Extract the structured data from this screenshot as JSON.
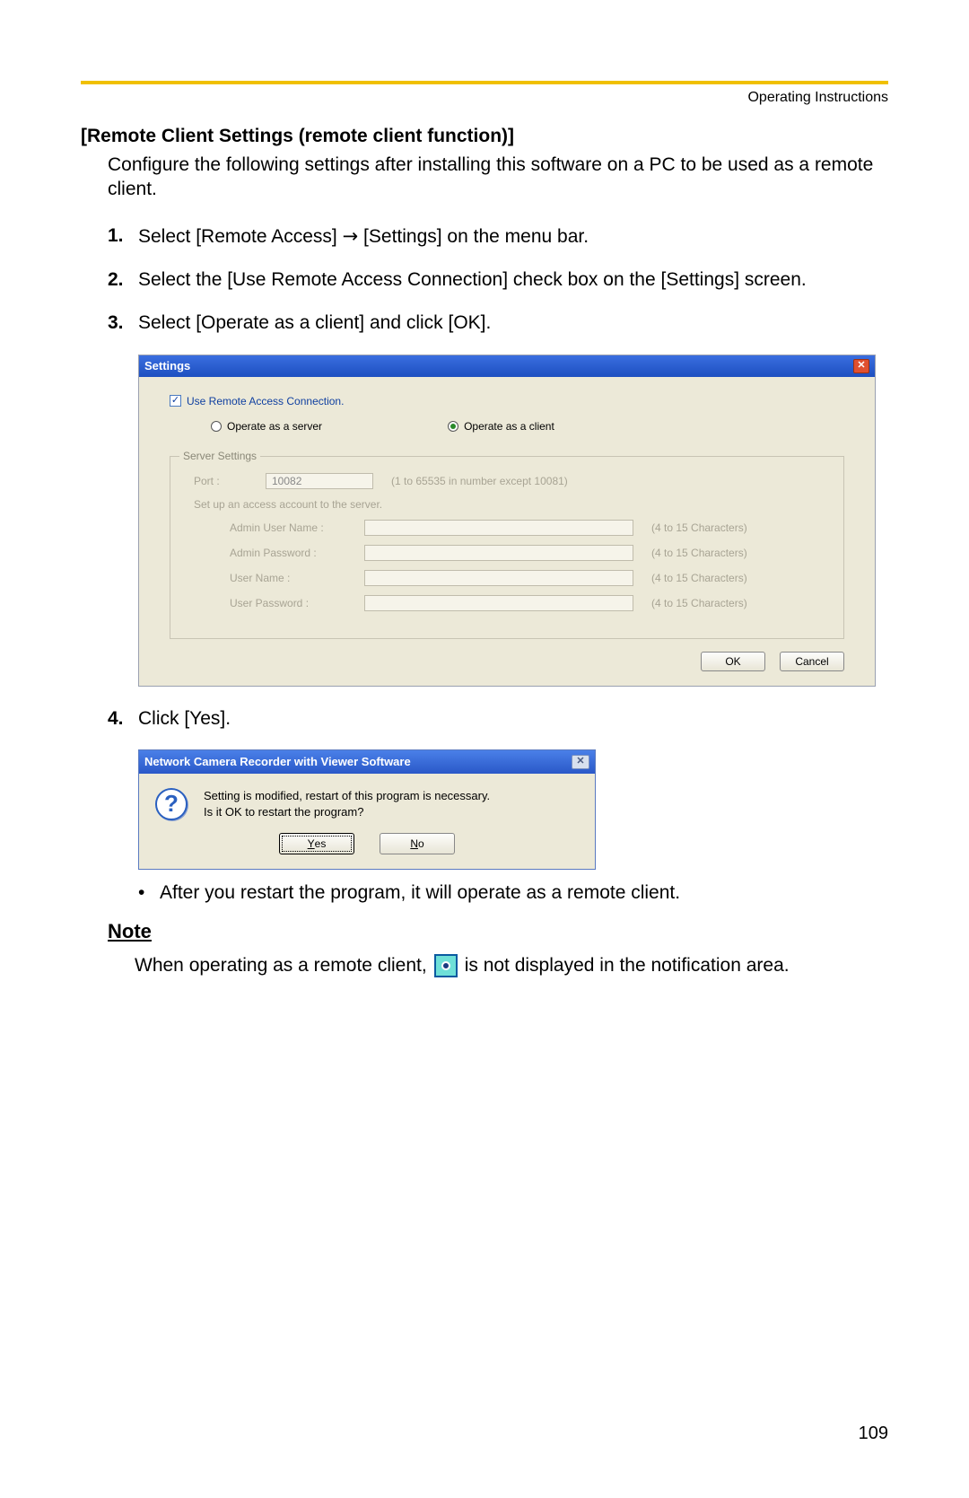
{
  "header": {
    "right_label": "Operating Instructions"
  },
  "section": {
    "title": "[Remote Client Settings (remote client function)]",
    "intro": "Configure the following settings after installing this software on a PC to be used as a remote client."
  },
  "steps": {
    "s1": {
      "num": "1.",
      "text_a": "Select [Remote Access] ",
      "arrow": "→",
      "text_b": " [Settings] on the menu bar."
    },
    "s2": {
      "num": "2.",
      "text": "Select the [Use Remote Access Connection] check box on the [Settings] screen."
    },
    "s3": {
      "num": "3.",
      "text": "Select [Operate as a client] and click [OK]."
    },
    "s4": {
      "num": "4.",
      "text": "Click [Yes]."
    }
  },
  "settings_window": {
    "title": "Settings",
    "use_remote_label": "Use Remote Access Connection.",
    "radio_server": "Operate as a server",
    "radio_client": "Operate as a client",
    "server_settings_legend": "Server Settings",
    "port_label": "Port :",
    "port_value": "10082",
    "port_hint": "(1 to 65535 in number except 10081)",
    "sub_note": "Set up an access account to the server.",
    "rows": {
      "admin_user": {
        "label": "Admin User Name :",
        "hint": "(4 to 15 Characters)"
      },
      "admin_pass": {
        "label": "Admin Password :",
        "hint": "(4 to 15 Characters)"
      },
      "user": {
        "label": "User Name :",
        "hint": "(4 to 15 Characters)"
      },
      "user_pass": {
        "label": "User Password :",
        "hint": "(4 to 15 Characters)"
      }
    },
    "ok": "OK",
    "cancel": "Cancel"
  },
  "confirm_dialog": {
    "title": "Network Camera Recorder with Viewer Software",
    "line1": "Setting is modified, restart of this program is necessary.",
    "line2": "Is it OK to restart the program?",
    "yes_u": "Y",
    "yes_rest": "es",
    "no_u": "N",
    "no_rest": "o"
  },
  "bullet": "After you restart the program, it will operate as a remote client.",
  "note": {
    "heading": "Note",
    "body_a": "When operating as a remote client, ",
    "body_b": " is not displayed in the notification area."
  },
  "page_number": "109"
}
